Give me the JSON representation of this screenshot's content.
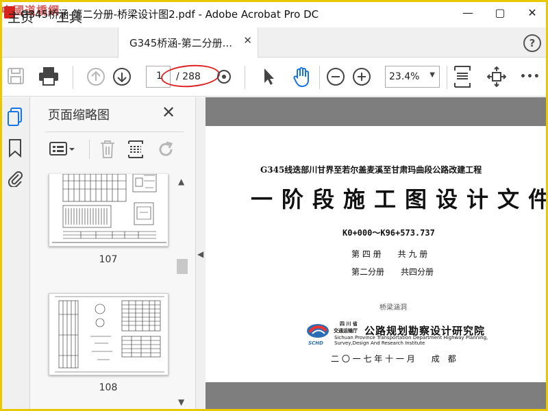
{
  "window": {
    "watermark": "中國道橋網",
    "title": "G345桥涵-第二分册-桥梁设计图2.pdf - Adobe Acrobat Pro DC",
    "minimize": "—",
    "maximize": "▢",
    "close": "✕"
  },
  "menu": {
    "home": "主页",
    "tools": "工具",
    "tab_label": "G345桥涵-第二分册...",
    "tab_close": "✕",
    "help": "?"
  },
  "toolbar": {
    "page_current": "1",
    "page_total": "/ 288",
    "zoom": "23.4%",
    "zoom_caret": "▼",
    "more": "•••"
  },
  "panel": {
    "title": "页面缩略图",
    "close": "✕",
    "thumbnails": [
      {
        "label": "107"
      },
      {
        "label": "108"
      }
    ],
    "scroll_up": "▲",
    "scroll_down": "▼"
  },
  "splitter": {
    "arrow": "◀"
  },
  "document": {
    "project_line": "G345线迭部川甘界至若尔盖麦溪至甘肃玛曲段公路改建工程",
    "heading": "一阶段施工图设计文件",
    "stake_range": "K0+000～K96+573.737",
    "volume": "第 四 册　　共 九 册",
    "sub_volume": "第二分册　　共四分册",
    "section": "桥梁涵洞",
    "logo_text": "SCHD",
    "institute_province": "四 川 省",
    "institute_dept": "交通运输厅",
    "institute_name": "公路规划勘察设计研究院",
    "institute_en_1": "Sichuan Province Transportation Department Highway Planning,",
    "institute_en_2": "Survey,Design And Research Institute",
    "date_place": "二 〇 一 七 年 十 一 月　　成　都"
  },
  "colors": {
    "accent": "#1473e6",
    "annotation_red": "#e02020",
    "doc_bg": "#7e7e7e",
    "frame_yellow": "#e8c800"
  }
}
